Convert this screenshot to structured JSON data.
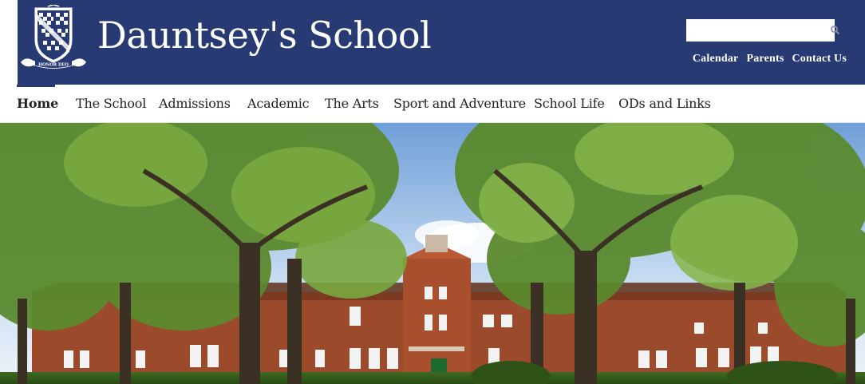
{
  "site": {
    "title": "Dauntsey's School",
    "crest_motto": "HONOR DEO"
  },
  "search": {
    "placeholder": "",
    "value": ""
  },
  "utility_links": [
    "Calendar",
    "Parents",
    "Contact Us"
  ],
  "nav": {
    "items": [
      "Home",
      "The School",
      "Admissions",
      "Academic",
      "The Arts",
      "Sport and Adventure",
      "School Life",
      "ODs and Links"
    ],
    "active": "Home"
  },
  "colors": {
    "header": "#283a74",
    "nav_text": "#222222",
    "brick": "#a0472a"
  },
  "icons": {
    "search": "search-icon",
    "crest": "school-crest-icon"
  }
}
